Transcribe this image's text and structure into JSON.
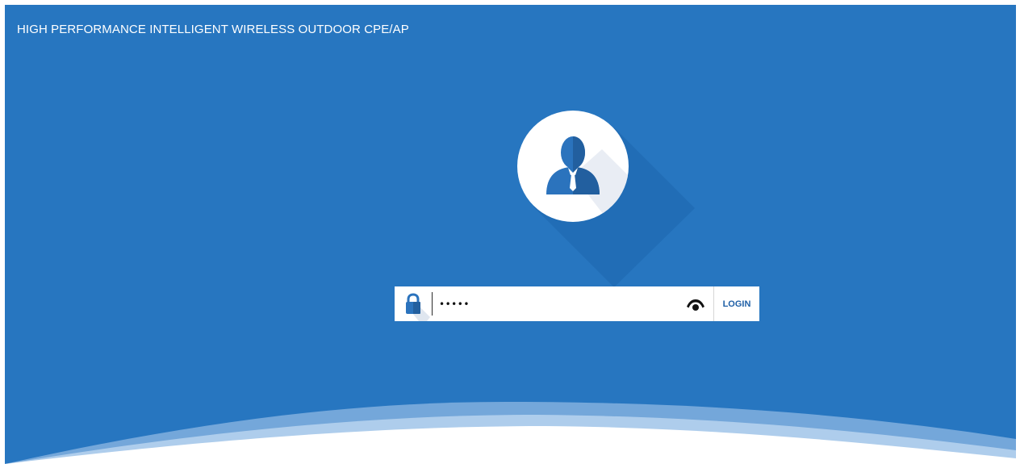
{
  "header": {
    "title": "HIGH PERFORMANCE INTELLIGENT WIRELESS OUTDOOR CPE/AP"
  },
  "login": {
    "password_value": "•••••",
    "lock_icon": "lock-icon",
    "eye_icon": "eye-icon",
    "button_label": "LOGIN"
  },
  "avatar": {
    "icon": "user-avatar-icon"
  },
  "colors": {
    "background": "#2776c0",
    "avatar_person": "#2b73bd",
    "login_text": "#1f5fa6",
    "wave_light": "#b9d3ee",
    "wave_mid": "#8fb8e3"
  }
}
